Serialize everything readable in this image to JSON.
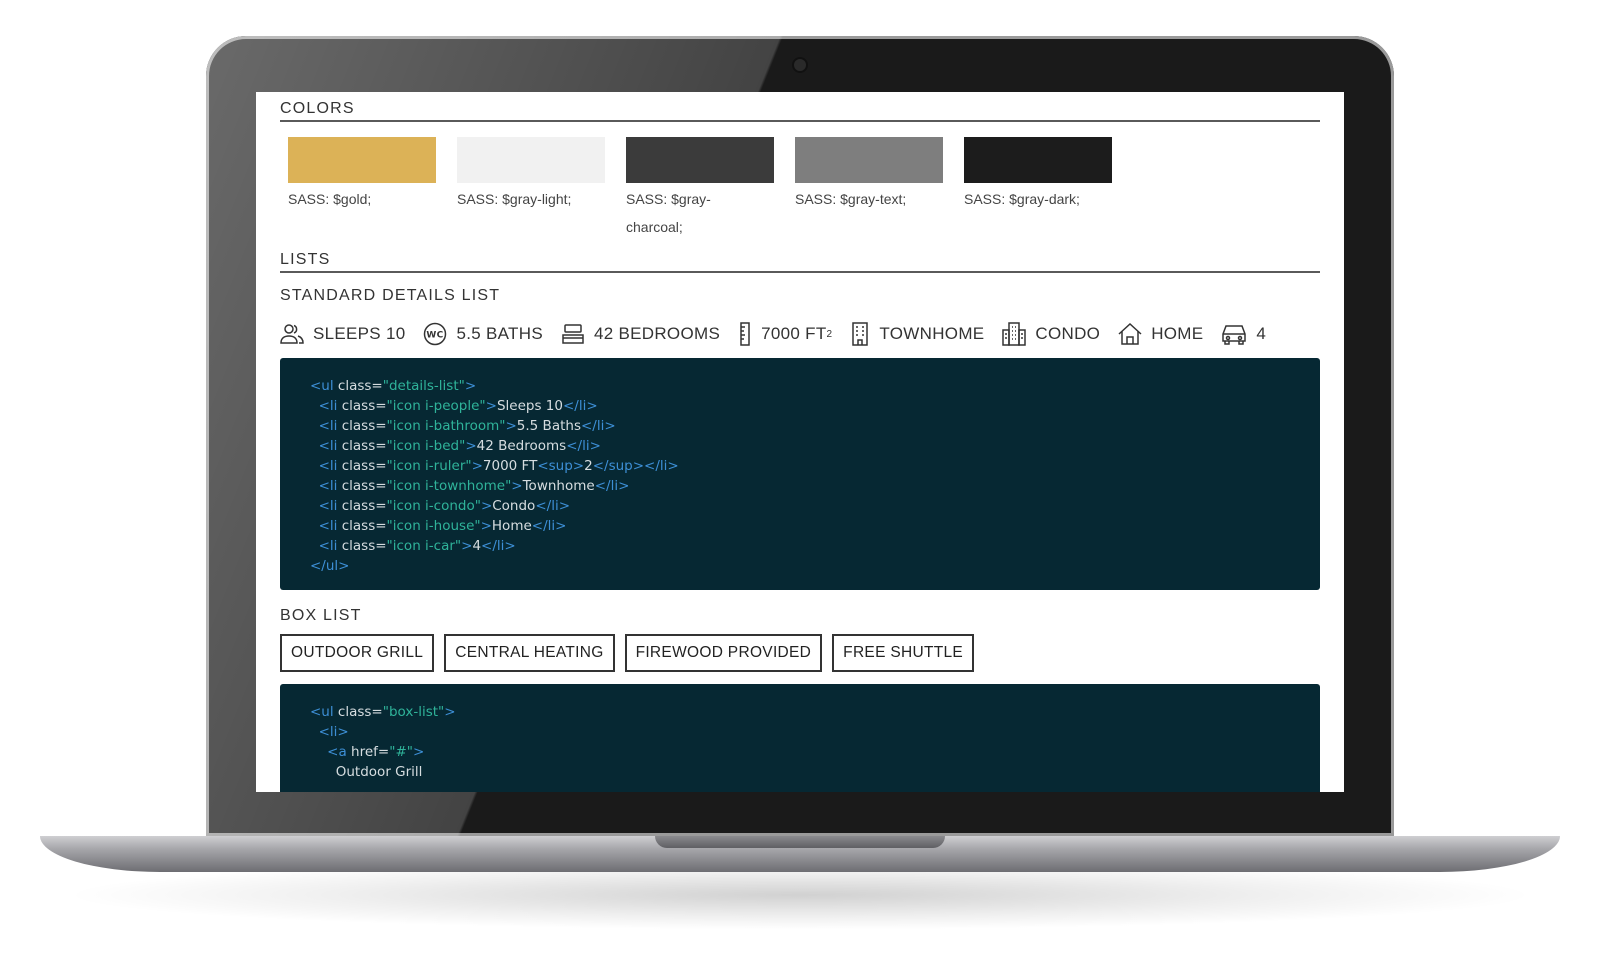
{
  "sections": {
    "colors": "COLORS",
    "lists": "LISTS",
    "standard_details": "STANDARD DETAILS LIST",
    "box_list": "BOX LIST"
  },
  "swatches": [
    {
      "label": "SASS: $gold;",
      "color": "#dcb257"
    },
    {
      "label": "SASS: $gray-light;",
      "color": "#f1f1f1"
    },
    {
      "label": "SASS: $gray-charcoal;",
      "color": "#3b3b3b"
    },
    {
      "label": "SASS: $gray-text;",
      "color": "#7e7e7e"
    },
    {
      "label": "SASS: $gray-dark;",
      "color": "#1c1c1c"
    }
  ],
  "details": [
    {
      "icon": "people-icon",
      "label": "SLEEPS 10"
    },
    {
      "icon": "bathroom-icon",
      "label": "5.5 BATHS",
      "icon_text": "WC"
    },
    {
      "icon": "bed-icon",
      "label": "42 BEDROOMS"
    },
    {
      "icon": "ruler-icon",
      "label": "7000 FT",
      "sup": "2"
    },
    {
      "icon": "townhome-icon",
      "label": "TOWNHOME"
    },
    {
      "icon": "condo-icon",
      "label": "CONDO"
    },
    {
      "icon": "house-icon",
      "label": "HOME"
    },
    {
      "icon": "car-icon",
      "label": "4"
    }
  ],
  "code_details": [
    {
      "indent": "",
      "parts": [
        [
          "tag",
          "<ul"
        ],
        [
          "txt",
          " class="
        ],
        [
          "val",
          "\"details-list\""
        ],
        [
          "tag",
          ">"
        ]
      ]
    },
    {
      "indent": "  ",
      "parts": [
        [
          "tag",
          "<li"
        ],
        [
          "txt",
          " class="
        ],
        [
          "val",
          "\"icon i-people\""
        ],
        [
          "tag",
          ">"
        ],
        [
          "txt",
          "Sleeps 10"
        ],
        [
          "tag",
          "</li>"
        ]
      ]
    },
    {
      "indent": "  ",
      "parts": [
        [
          "tag",
          "<li"
        ],
        [
          "txt",
          " class="
        ],
        [
          "val",
          "\"icon i-bathroom\""
        ],
        [
          "tag",
          ">"
        ],
        [
          "txt",
          "5.5 Baths"
        ],
        [
          "tag",
          "</li>"
        ]
      ]
    },
    {
      "indent": "  ",
      "parts": [
        [
          "tag",
          "<li"
        ],
        [
          "txt",
          " class="
        ],
        [
          "val",
          "\"icon i-bed\""
        ],
        [
          "tag",
          ">"
        ],
        [
          "txt",
          "42 Bedrooms"
        ],
        [
          "tag",
          "</li>"
        ]
      ]
    },
    {
      "indent": "  ",
      "parts": [
        [
          "tag",
          "<li"
        ],
        [
          "txt",
          " class="
        ],
        [
          "val",
          "\"icon i-ruler\""
        ],
        [
          "tag",
          ">"
        ],
        [
          "txt",
          "7000 FT"
        ],
        [
          "tag",
          "<sup>"
        ],
        [
          "txt",
          "2"
        ],
        [
          "tag",
          "</sup></li>"
        ]
      ]
    },
    {
      "indent": "  ",
      "parts": [
        [
          "tag",
          "<li"
        ],
        [
          "txt",
          " class="
        ],
        [
          "val",
          "\"icon i-townhome\""
        ],
        [
          "tag",
          ">"
        ],
        [
          "txt",
          "Townhome"
        ],
        [
          "tag",
          "</li>"
        ]
      ]
    },
    {
      "indent": "  ",
      "parts": [
        [
          "tag",
          "<li"
        ],
        [
          "txt",
          " class="
        ],
        [
          "val",
          "\"icon i-condo\""
        ],
        [
          "tag",
          ">"
        ],
        [
          "txt",
          "Condo"
        ],
        [
          "tag",
          "</li>"
        ]
      ]
    },
    {
      "indent": "  ",
      "parts": [
        [
          "tag",
          "<li"
        ],
        [
          "txt",
          " class="
        ],
        [
          "val",
          "\"icon i-house\""
        ],
        [
          "tag",
          ">"
        ],
        [
          "txt",
          "Home"
        ],
        [
          "tag",
          "</li>"
        ]
      ]
    },
    {
      "indent": "  ",
      "parts": [
        [
          "tag",
          "<li"
        ],
        [
          "txt",
          " class="
        ],
        [
          "val",
          "\"icon i-car\""
        ],
        [
          "tag",
          ">"
        ],
        [
          "txt",
          "4"
        ],
        [
          "tag",
          "</li>"
        ]
      ]
    },
    {
      "indent": "",
      "parts": [
        [
          "tag",
          "</ul>"
        ]
      ]
    }
  ],
  "box_items": [
    "OUTDOOR GRILL",
    "CENTRAL HEATING",
    "FIREWOOD PROVIDED",
    "FREE SHUTTLE"
  ],
  "code_box": [
    {
      "indent": "",
      "parts": [
        [
          "tag",
          "<ul"
        ],
        [
          "txt",
          " class="
        ],
        [
          "val",
          "\"box-list\""
        ],
        [
          "tag",
          ">"
        ]
      ]
    },
    {
      "indent": "  ",
      "parts": [
        [
          "tag",
          "<li>"
        ]
      ]
    },
    {
      "indent": "    ",
      "parts": [
        [
          "tag",
          "<a"
        ],
        [
          "txt",
          " href="
        ],
        [
          "val",
          "\"#\""
        ],
        [
          "tag",
          ">"
        ]
      ]
    },
    {
      "indent": "      ",
      "parts": [
        [
          "txt",
          "Outdoor Grill"
        ]
      ]
    }
  ]
}
